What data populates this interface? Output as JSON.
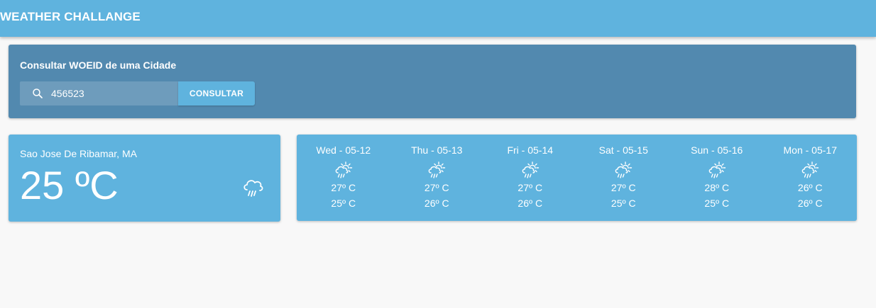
{
  "header": {
    "title": "WEATHER CHALLANGE"
  },
  "search": {
    "title": "Consultar WOEID de uma Cidade",
    "value": "456523",
    "icon": "search-icon",
    "button_label": "CONSULTAR"
  },
  "current": {
    "city": "Sao Jose De Ribamar, MA",
    "temperature": "25 ºC",
    "icon": "rain-cloud-icon"
  },
  "forecast": [
    {
      "day": "Wed - 05-12",
      "max": "27º C",
      "min": "25º C",
      "icon": "sun-rain-icon"
    },
    {
      "day": "Thu - 05-13",
      "max": "27º C",
      "min": "26º C",
      "icon": "sun-rain-icon"
    },
    {
      "day": "Fri - 05-14",
      "max": "27º C",
      "min": "26º C",
      "icon": "sun-rain-icon"
    },
    {
      "day": "Sat - 05-15",
      "max": "27º C",
      "min": "25º C",
      "icon": "sun-rain-icon"
    },
    {
      "day": "Sun - 05-16",
      "max": "28º C",
      "min": "25º C",
      "icon": "sun-rain-icon"
    },
    {
      "day": "Mon - 05-17",
      "max": "26º C",
      "min": "26º C",
      "icon": "sun-rain-icon"
    }
  ],
  "colors": {
    "primary": "#5fb3de",
    "search_card": "#5289af",
    "background": "#f8f8f8"
  }
}
